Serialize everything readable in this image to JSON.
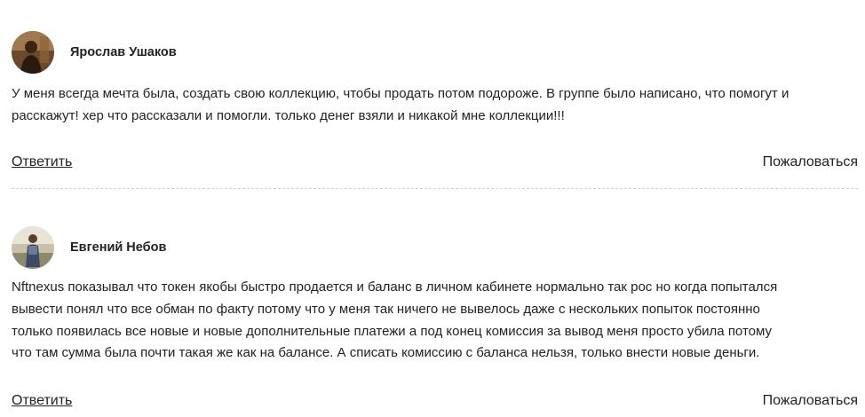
{
  "comments": [
    {
      "author": "Ярослав Ушаков",
      "avatar_icon": "user-photo-icon",
      "text_lines": [
        "У меня всегда мечта была, создать свою коллекцию, чтобы продать потом подороже. В группе было написано, что помогут и",
        "расскажут! хер что рассказали и помогли. только денег взяли и никакой мне коллекции!!!"
      ],
      "reply_label": "Ответить",
      "report_label": "Пожаловаться"
    },
    {
      "author": "Евгений Небов",
      "avatar_icon": "user-photo-icon",
      "text_lines": [
        "Nftnexus показывал что токен якобы быстро продается и баланс в личном кабинете нормально так рос но когда попытался",
        "вывести понял что все обман по факту потому что у меня так ничего не вывелось даже с нескольких попыток постоянно",
        "только появилась все новые и новые дополнительные платежи а под конец комиссия за вывод меня просто убила потому",
        "что там сумма была почти такая же как на балансе. А списать комиссию с баланса нельзя, только внести новые деньги."
      ],
      "reply_label": "Ответить",
      "report_label": "Пожаловаться"
    }
  ]
}
